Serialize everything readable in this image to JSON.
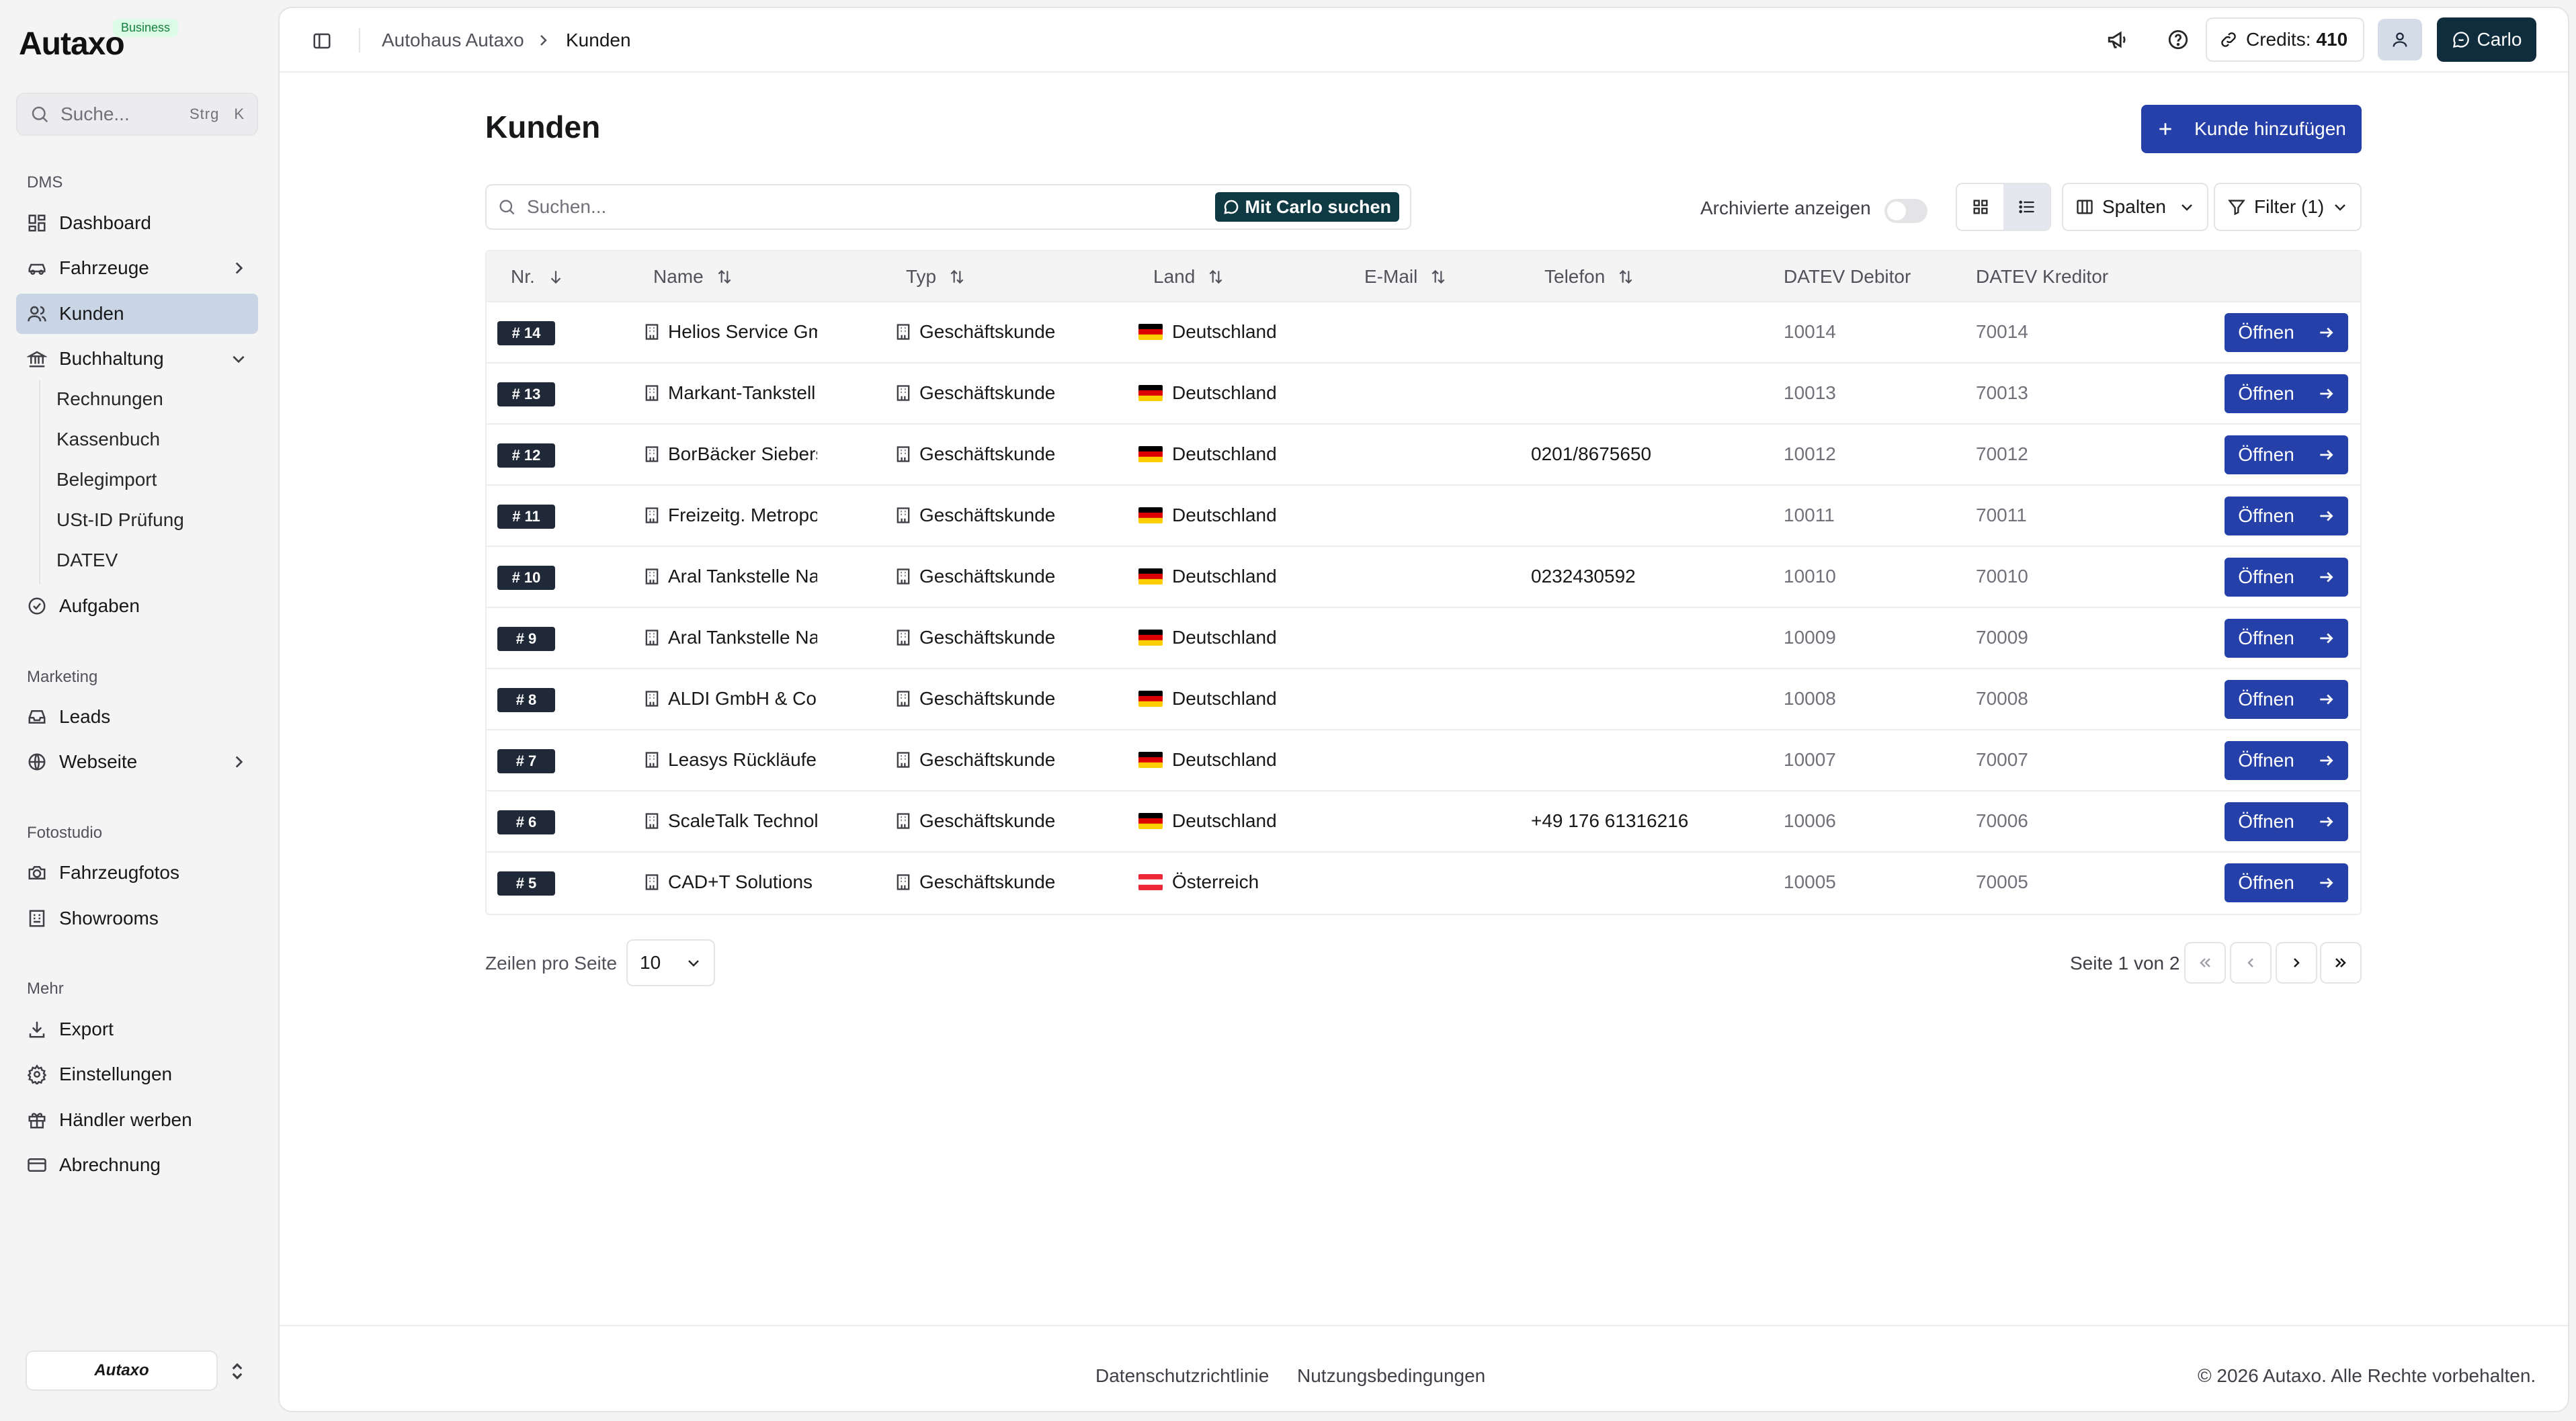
{
  "brand": {
    "name": "Autaxo",
    "badge": "Business",
    "mini_logo": "Autaxo"
  },
  "sidebar": {
    "search": {
      "placeholder": "Suche...",
      "shortcut_mod": "Strg",
      "shortcut_key": "K"
    },
    "groups": {
      "dms": "DMS",
      "marketing": "Marketing",
      "fotostudio": "Fotostudio",
      "mehr": "Mehr"
    },
    "items": {
      "dashboard": "Dashboard",
      "fahrzeuge": "Fahrzeuge",
      "kunden": "Kunden",
      "buchhaltung": "Buchhaltung",
      "aufgaben": "Aufgaben",
      "leads": "Leads",
      "webseite": "Webseite",
      "fahrzeugfotos": "Fahrzeugfotos",
      "showrooms": "Showrooms",
      "export": "Export",
      "einstellungen": "Einstellungen",
      "haendler_werben": "Händler werben",
      "abrechnung": "Abrechnung"
    },
    "buchhaltung_sub": [
      "Rechnungen",
      "Kassenbuch",
      "Belegimport",
      "USt-ID Prüfung",
      "DATEV"
    ]
  },
  "header": {
    "breadcrumb": [
      "Autohaus Autaxo",
      "Kunden"
    ],
    "credits_label": "Credits:",
    "credits_value": "410",
    "user_button": "Carlo"
  },
  "page": {
    "title": "Kunden",
    "add_button": "Kunde hinzufügen",
    "search_placeholder": "Suchen...",
    "carlo_search": "Mit Carlo suchen",
    "archived_label": "Archivierte anzeigen",
    "archived_on": false,
    "columns_button": "Spalten",
    "filter_button": "Filter (1)"
  },
  "table": {
    "headers": {
      "nr": "Nr.",
      "name": "Name",
      "typ": "Typ",
      "land": "Land",
      "email": "E-Mail",
      "telefon": "Telefon",
      "datev_debitor": "DATEV Debitor",
      "datev_kreditor": "DATEV Kreditor"
    },
    "open_label": "Öffnen",
    "rows": [
      {
        "nr": "# 14",
        "name": "Helios Service Gm",
        "typ": "Geschäftskunde",
        "land": "Deutschland",
        "flag": "de",
        "telefon": "",
        "debitor": "10014",
        "kreditor": "70014"
      },
      {
        "nr": "# 13",
        "name": "Markant-Tankstell",
        "typ": "Geschäftskunde",
        "land": "Deutschland",
        "flag": "de",
        "telefon": "",
        "debitor": "10013",
        "kreditor": "70013"
      },
      {
        "nr": "# 12",
        "name": "BorBäcker Siebers",
        "typ": "Geschäftskunde",
        "land": "Deutschland",
        "flag": "de",
        "telefon": "0201/8675650",
        "debitor": "10012",
        "kreditor": "70012"
      },
      {
        "nr": "# 11",
        "name": "Freizeitg. Metropo",
        "typ": "Geschäftskunde",
        "land": "Deutschland",
        "flag": "de",
        "telefon": "",
        "debitor": "10011",
        "kreditor": "70011"
      },
      {
        "nr": "# 10",
        "name": "Aral Tankstelle Na",
        "typ": "Geschäftskunde",
        "land": "Deutschland",
        "flag": "de",
        "telefon": "0232430592",
        "debitor": "10010",
        "kreditor": "70010"
      },
      {
        "nr": "# 9",
        "name": "Aral Tankstelle Na",
        "typ": "Geschäftskunde",
        "land": "Deutschland",
        "flag": "de",
        "telefon": "",
        "debitor": "10009",
        "kreditor": "70009"
      },
      {
        "nr": "# 8",
        "name": "ALDI GmbH & Co.",
        "typ": "Geschäftskunde",
        "land": "Deutschland",
        "flag": "de",
        "telefon": "",
        "debitor": "10008",
        "kreditor": "70008"
      },
      {
        "nr": "# 7",
        "name": "Leasys Rückläufe",
        "typ": "Geschäftskunde",
        "land": "Deutschland",
        "flag": "de",
        "telefon": "",
        "debitor": "10007",
        "kreditor": "70007"
      },
      {
        "nr": "# 6",
        "name": "ScaleTalk Technol",
        "typ": "Geschäftskunde",
        "land": "Deutschland",
        "flag": "de",
        "telefon": "+49 176 61316216",
        "debitor": "10006",
        "kreditor": "70006"
      },
      {
        "nr": "# 5",
        "name": "CAD+T Solutions",
        "typ": "Geschäftskunde",
        "land": "Österreich",
        "flag": "at",
        "telefon": "",
        "debitor": "10005",
        "kreditor": "70005"
      }
    ]
  },
  "pagination": {
    "rows_per_page_label": "Zeilen pro Seite",
    "rows_per_page": "10",
    "page_info": "Seite 1 von 2"
  },
  "footer": {
    "privacy": "Datenschutzrichtlinie",
    "terms": "Nutzungsbedingungen",
    "copyright": "© 2026 Autaxo. Alle Rechte vorbehalten."
  },
  "colors": {
    "primary": "#2540a8",
    "dark_button": "#0f2d3c",
    "active_nav": "#c9d5e4",
    "badge": "#1f2937"
  }
}
